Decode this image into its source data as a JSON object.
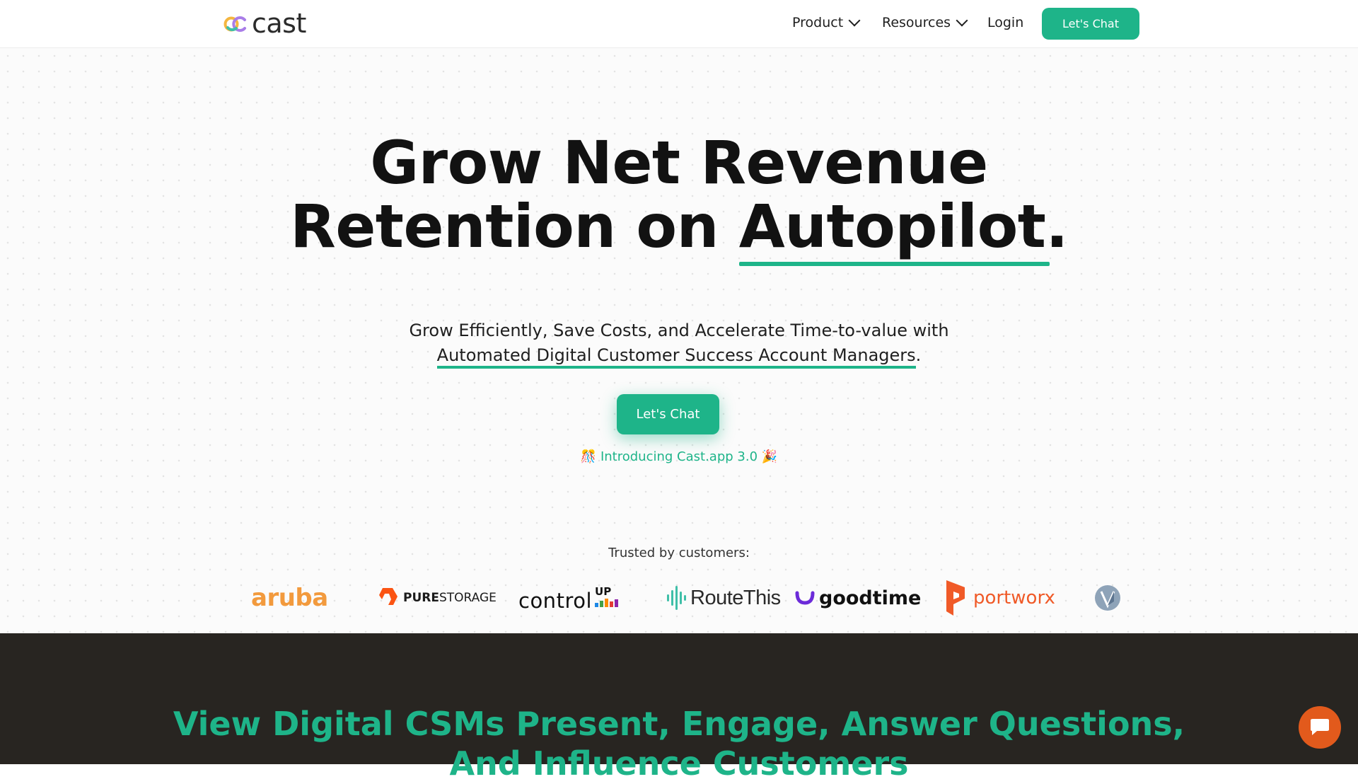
{
  "nav": {
    "logo_text": "cast",
    "items": [
      {
        "label": "Product",
        "has_dropdown": true
      },
      {
        "label": "Resources",
        "has_dropdown": true
      },
      {
        "label": "Login",
        "has_dropdown": false
      }
    ],
    "cta_label": "Let's Chat"
  },
  "hero": {
    "title_line1": "Grow Net Revenue",
    "title_line2_a": "Retention on ",
    "title_line2_b": "Autopilot.",
    "subtitle_line1": "Grow Efficiently, Save Costs, and Accelerate Time-to-value with",
    "subtitle_line2_link": "Automated Digital Customer Success Account Managers",
    "subtitle_line2_end": ".",
    "cta_label": "Let's Chat",
    "intro_left_emoji": "🎊",
    "intro_text": "Introducing Cast.app 3.0",
    "intro_right_emoji": "🎉"
  },
  "customers": {
    "heading": "Trusted by customers:",
    "logos": [
      {
        "name": "aruba",
        "text": "aruba"
      },
      {
        "name": "purestorage",
        "text_bold": "PURE",
        "text_light": "STORAGE"
      },
      {
        "name": "controlup",
        "text": "control",
        "sup": "UP"
      },
      {
        "name": "routethis",
        "text": "RouteThis"
      },
      {
        "name": "goodtime",
        "text": "goodtime"
      },
      {
        "name": "portworx",
        "text": "portworx"
      },
      {
        "name": "v-logo",
        "text": ""
      }
    ]
  },
  "section2": {
    "title_line1": "View Digital CSMs Present, Engage, Answer Questions,",
    "title_line2": "And Influence Customers"
  },
  "colors": {
    "accent": "#1eb489",
    "dark_bg": "#282521",
    "chat_bubble": "#e25a1c"
  },
  "icons": {
    "chat_widget": "chat-bubble-icon",
    "dropdown": "chevron-down-icon"
  }
}
